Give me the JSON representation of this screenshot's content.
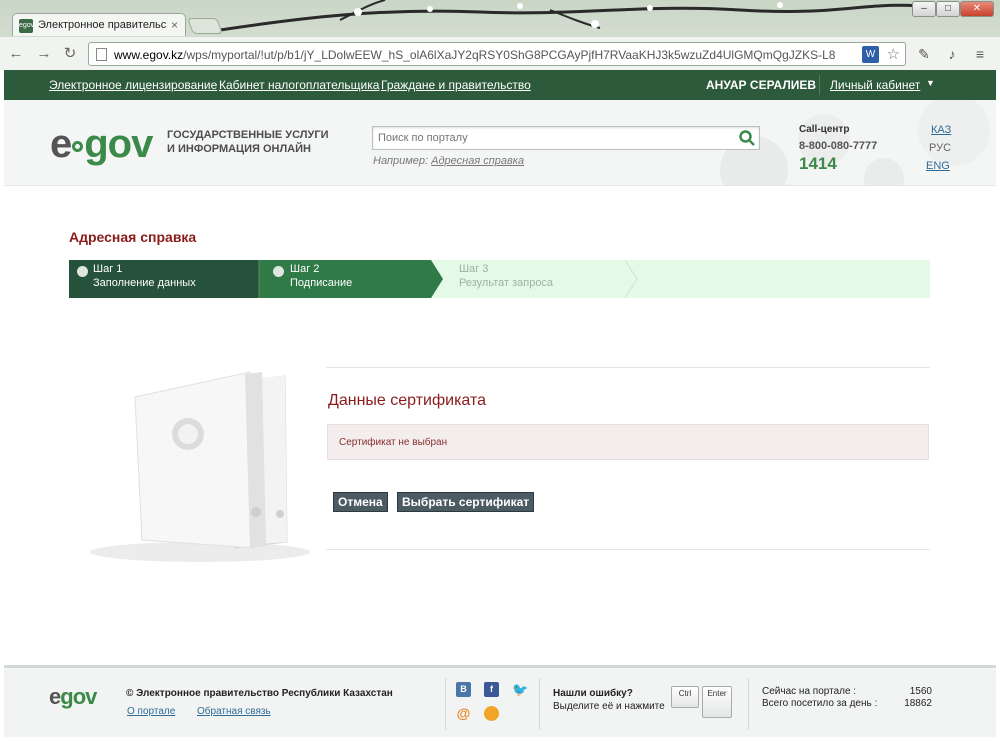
{
  "browser": {
    "tab_title": "Электронное правительство",
    "tab_favicon": "egov",
    "url_host": "www.egov.kz",
    "url_path": "/wps/myportal/!ut/p/b1/jY_LDolwEEW_hS_olA6lXaJY2qRSY0ShG8PCGAyPjfH7RVaaKHJ3k5wzuZd4UlGMQmQgJZKS-L8",
    "ext_icon_label": "W"
  },
  "topbar": {
    "links": [
      "Электронное лицензирование",
      "Кабинет налогоплательщика",
      "Граждане и правительство"
    ],
    "username": "АНУАР СЕРАЛИЕВ",
    "cabinet": "Личный кабинет"
  },
  "header": {
    "logo_e": "e",
    "logo_gov": "gov",
    "tagline": "Государственные услуги и информация онлайн",
    "search_placeholder": "Поиск по порталу",
    "example_label": "Например:",
    "example_link": "Адресная справка",
    "callcenter_label": "Call-центр",
    "callcenter_phone": "8-800-080-7777",
    "callcenter_short": "1414",
    "languages": [
      "КАЗ",
      "РУС",
      "ENG"
    ]
  },
  "main": {
    "page_title": "Адресная справка",
    "steps": [
      {
        "number": "Шаг 1",
        "label": "Заполнение данных",
        "state": "completed"
      },
      {
        "number": "Шаг 2",
        "label": "Подписание",
        "state": "current"
      },
      {
        "number": "Шаг 3",
        "label": "Результат запроса",
        "state": "pending"
      }
    ],
    "section_title": "Данные сертификата",
    "notice": "Сертификат не выбран",
    "cancel_button": "Отмена",
    "select_button": "Выбрать сертификат"
  },
  "footer": {
    "logo_e": "e",
    "logo_gov": "gov",
    "copyright": "© Электронное правительство Республики Казахстан",
    "about_link": "О портале",
    "feedback_link": "Обратная связь",
    "social_icons": [
      "vk-icon",
      "facebook-icon",
      "twitter-icon",
      "mail-icon",
      "chat-icon"
    ],
    "error_title": "Нашли ошибку?",
    "error_hint": "Выделите её и нажмите",
    "key_ctrl": "Ctrl",
    "key_enter": "Enter",
    "online_label": "Сейчас на портале :",
    "online_value": "1560",
    "daily_label": "Всего посетило за день :",
    "daily_value": "18862"
  },
  "colors": {
    "brand_green": "#2d5a3a",
    "accent_green": "#3b8a4a",
    "title_red": "#8a1c1c",
    "button_gray": "#4b5a63"
  }
}
